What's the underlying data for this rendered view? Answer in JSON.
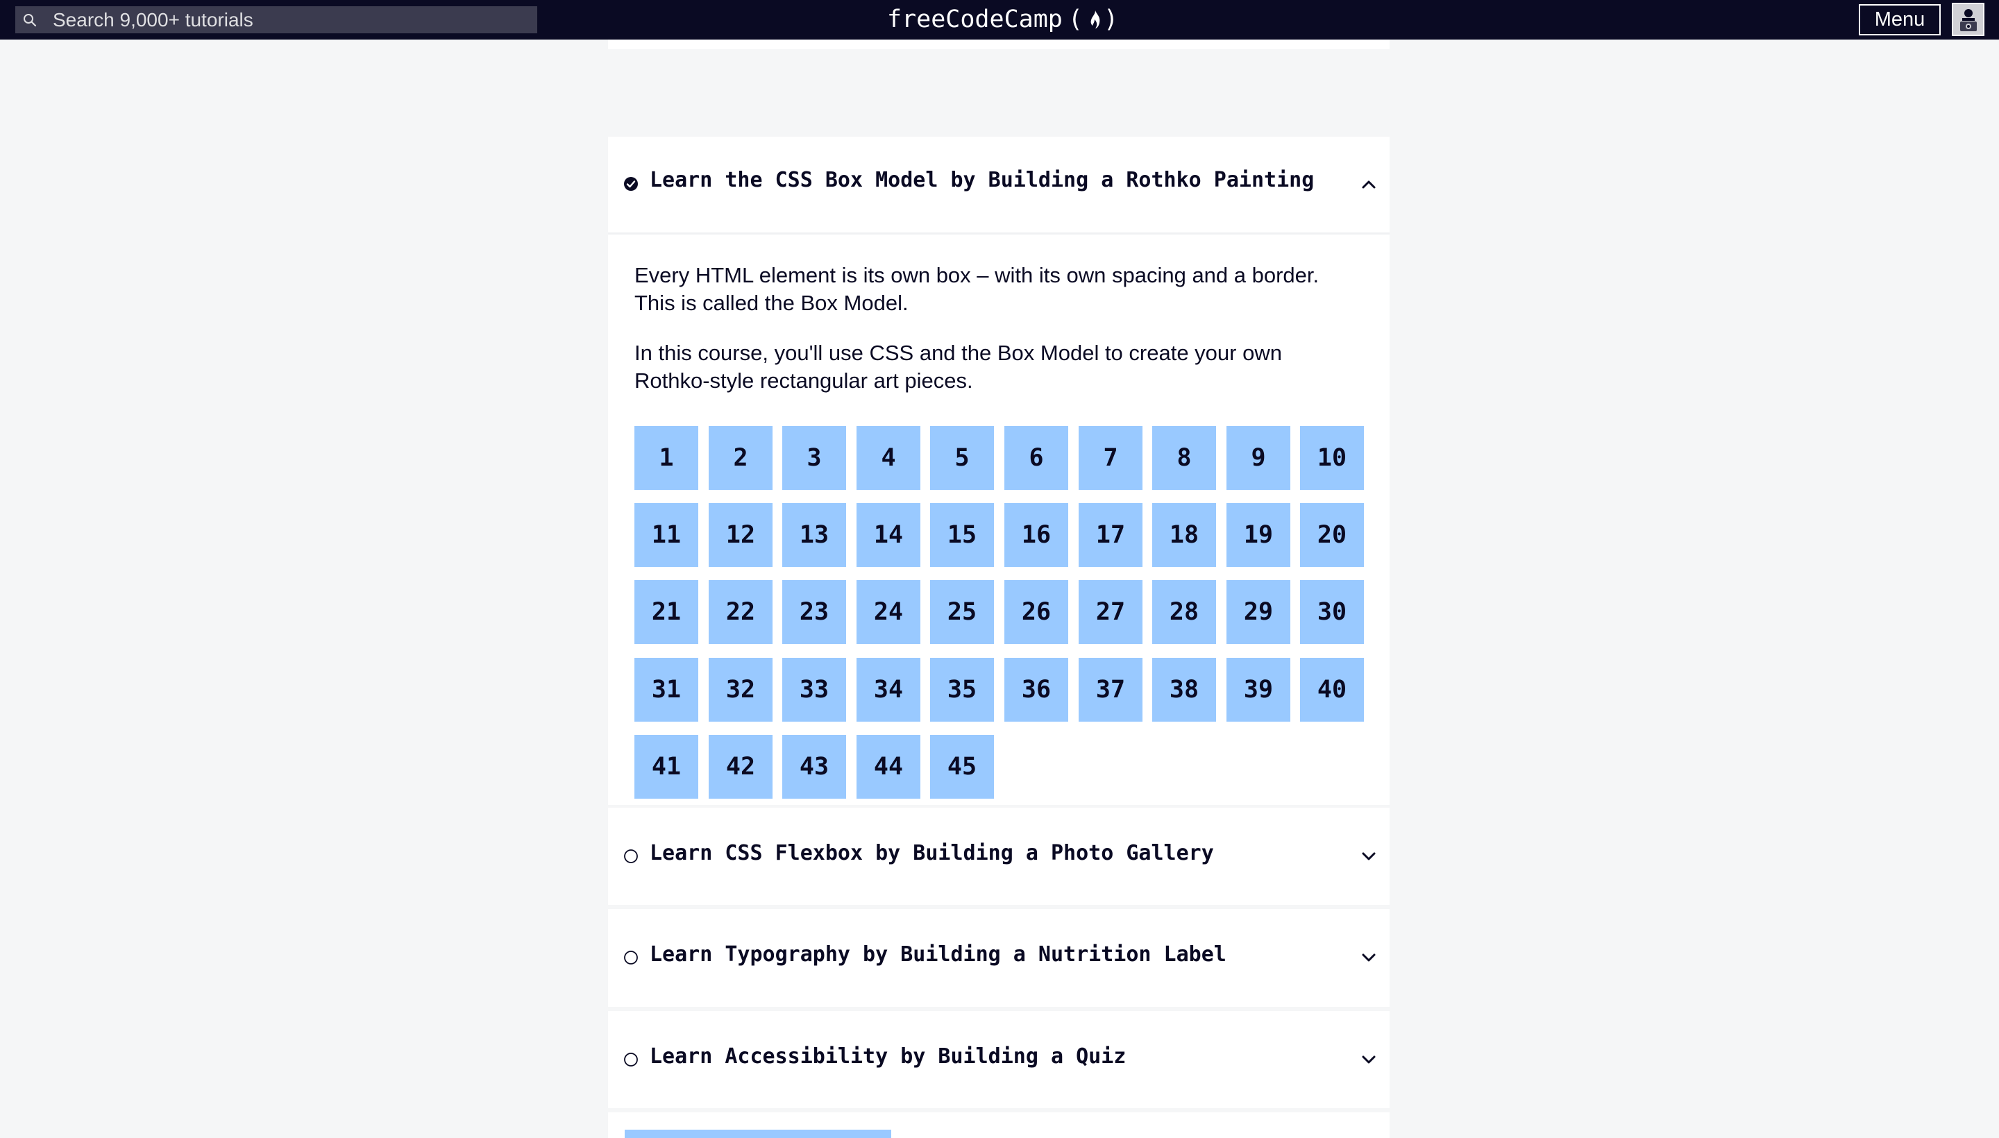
{
  "nav": {
    "search_placeholder": "Search 9,000+ tutorials",
    "logo_text": "freeCodeCamp",
    "logo_paren_open": "(",
    "logo_paren_close": ")",
    "menu_label": "Menu"
  },
  "colors": {
    "nav_bg": "#0a0a23",
    "page_bg": "#f5f6f7",
    "card_bg": "#ffffff",
    "step_bg": "#99c9ff",
    "text": "#0a0a23"
  },
  "expanded_block": {
    "title": "Learn the CSS Box Model by Building a Rothko Painting",
    "status_icon": "check-circle-icon",
    "completed": true,
    "expanded": true,
    "description_1": "Every HTML element is its own box – with its own spacing and a border. This is called the Box Model.",
    "description_2": "In this course, you'll use CSS and the Box Model to create your own Rothko-style rectangular art pieces.",
    "steps": [
      "1",
      "2",
      "3",
      "4",
      "5",
      "6",
      "7",
      "8",
      "9",
      "10",
      "11",
      "12",
      "13",
      "14",
      "15",
      "16",
      "17",
      "18",
      "19",
      "20",
      "21",
      "22",
      "23",
      "24",
      "25",
      "26",
      "27",
      "28",
      "29",
      "30",
      "31",
      "32",
      "33",
      "34",
      "35",
      "36",
      "37",
      "38",
      "39",
      "40",
      "41",
      "42",
      "43",
      "44",
      "45"
    ]
  },
  "collapsed_blocks": [
    {
      "title": "Learn CSS Flexbox by Building a Photo Gallery",
      "status_icon": "empty-circle-icon",
      "completed": false
    },
    {
      "title": "Learn Typography by Building a Nutrition Label",
      "status_icon": "empty-circle-icon",
      "completed": false
    },
    {
      "title": "Learn Accessibility by Building a Quiz",
      "status_icon": "empty-circle-icon",
      "completed": false
    }
  ]
}
